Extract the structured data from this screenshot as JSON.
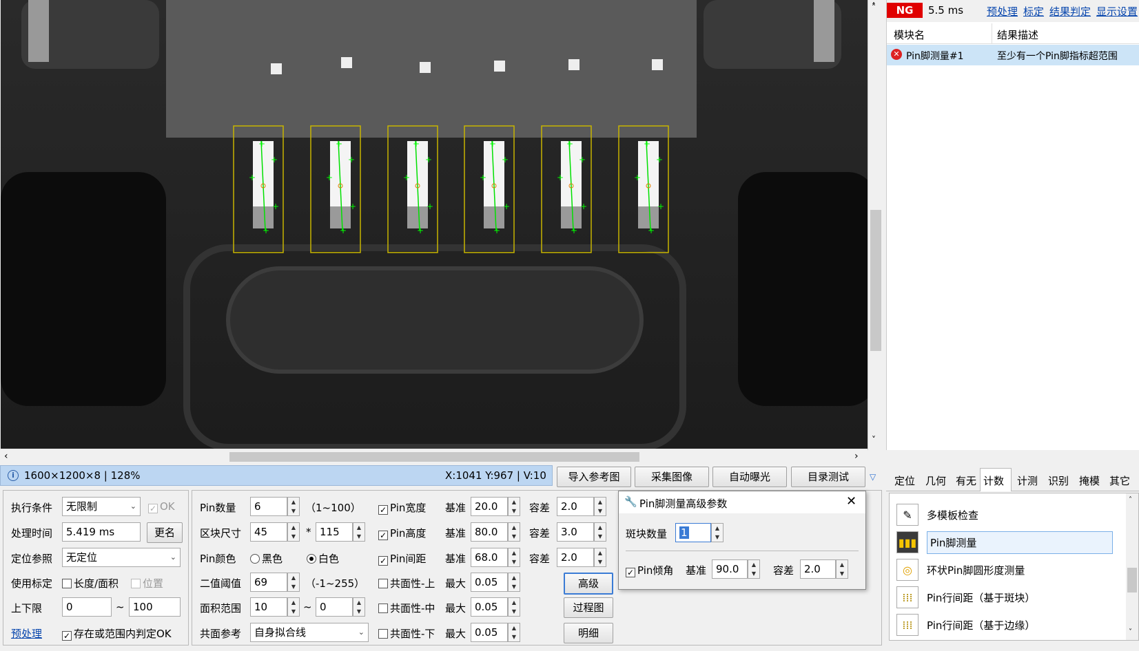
{
  "status": {
    "result": "NG",
    "time": "5.5 ms"
  },
  "top_links": [
    "预处理",
    "标定",
    "结果判定",
    "显示设置"
  ],
  "result_table": {
    "headers": [
      "模块名",
      "结果描述"
    ],
    "rows": [
      {
        "name": "Pin脚测量#1",
        "desc": "至少有一个Pin脚指标超范围"
      }
    ]
  },
  "info": {
    "size": "1600×1200×8 | 128%",
    "coords": "X:1041  Y:967 | V:10"
  },
  "toolbar_buttons": [
    "导入参考图",
    "采集图像",
    "自动曝光",
    "目录测试"
  ],
  "tabs": [
    "定位",
    "几何",
    "有无",
    "计数",
    "计测",
    "识别",
    "掩模",
    "其它"
  ],
  "active_tab": "计数",
  "tools": [
    "多模板检查",
    "Pin脚测量",
    "环状Pin脚圆形度测量",
    "Pin行间距（基于斑块）",
    "Pin行间距（基于边缘）"
  ],
  "left_form": {
    "exec_label": "执行条件",
    "exec_value": "无限制",
    "ok_label": "OK",
    "time_label": "处理时间",
    "time_value": "5.419 ms",
    "rename": "更名",
    "pos_label": "定位参照",
    "pos_value": "无定位",
    "calib_label": "使用标定",
    "calib_len": "长度/面积",
    "calib_pos": "位置",
    "limit_label": "上下限",
    "limit_low": "0",
    "limit_high": "100",
    "tilde": "~",
    "preproc": "预处理",
    "judge": "存在或范围内判定OK"
  },
  "mid_form": {
    "count_label": "Pin数量",
    "count_value": "6",
    "count_range": "（1~100）",
    "block_label": "区块尺寸",
    "block_w": "45",
    "block_h": "115",
    "times": "*",
    "color_label": "Pin颜色",
    "black": "黑色",
    "white": "白色",
    "thresh_label": "二值阈值",
    "thresh_value": "69",
    "thresh_range": "（-1~255）",
    "area_label": "面积范围",
    "area_low": "10",
    "area_high": "0",
    "tilde": "~",
    "ref_label": "共面参考",
    "ref_value": "自身拟合线"
  },
  "metrics": [
    {
      "label": "Pin宽度",
      "checked": true,
      "base_label": "基准",
      "base": "20.0",
      "tol_label": "容差",
      "tol": "2.0"
    },
    {
      "label": "Pin高度",
      "checked": true,
      "base_label": "基准",
      "base": "80.0",
      "tol_label": "容差",
      "tol": "3.0"
    },
    {
      "label": "Pin间距",
      "checked": true,
      "base_label": "基准",
      "base": "68.0",
      "tol_label": "容差",
      "tol": "2.0"
    },
    {
      "label": "共面性-上",
      "checked": false,
      "base_label": "最大",
      "base": "0.05"
    },
    {
      "label": "共面性-中",
      "checked": false,
      "base_label": "最大",
      "base": "0.05"
    },
    {
      "label": "共面性-下",
      "checked": false,
      "base_label": "最大",
      "base": "0.05"
    }
  ],
  "side_buttons": [
    "高级",
    "过程图",
    "明细"
  ],
  "dialog": {
    "title": "Pin脚测量高级参数",
    "blob_label": "斑块数量",
    "blob_value": "1",
    "angle_label": "Pin倾角",
    "base_label": "基准",
    "base": "90.0",
    "tol_label": "容差",
    "tol": "2.0"
  }
}
